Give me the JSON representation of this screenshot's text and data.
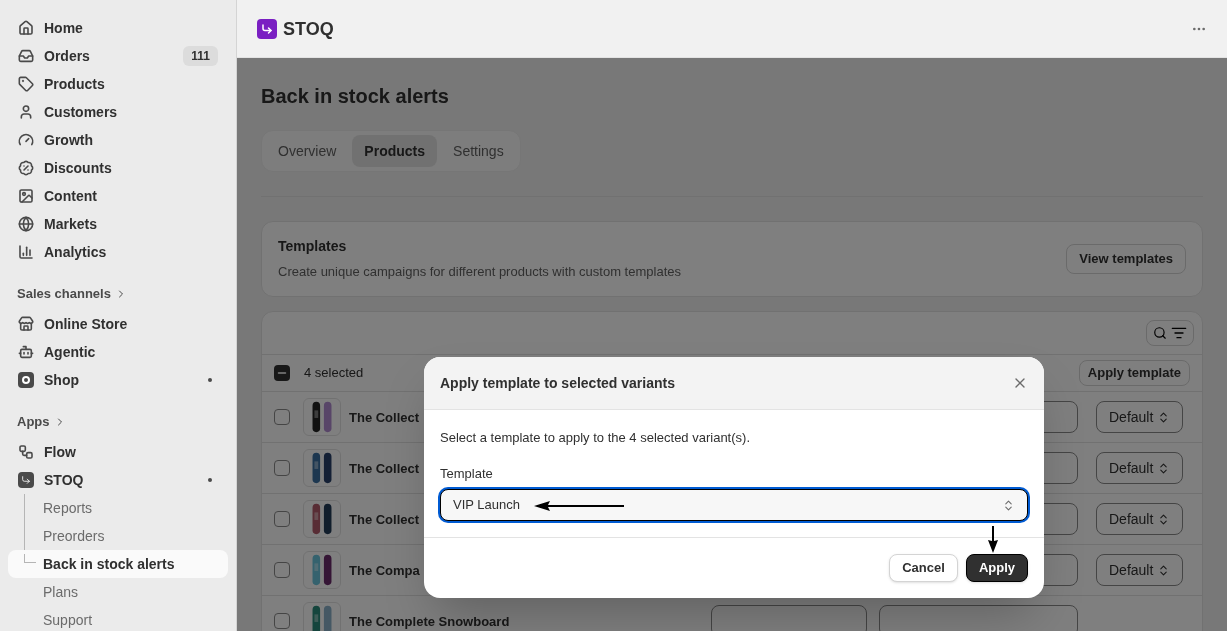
{
  "sidebar": {
    "items": [
      {
        "label": "Home",
        "selected": false
      },
      {
        "label": "Orders",
        "badge": "111",
        "selected": false
      },
      {
        "label": "Products",
        "selected": false
      },
      {
        "label": "Customers",
        "selected": false
      },
      {
        "label": "Growth",
        "selected": false
      },
      {
        "label": "Discounts",
        "selected": false
      },
      {
        "label": "Content",
        "selected": false
      },
      {
        "label": "Markets",
        "selected": false
      },
      {
        "label": "Analytics",
        "selected": false
      }
    ],
    "sections": [
      {
        "title": "Sales channels",
        "items": [
          {
            "label": "Online Store",
            "dot": false,
            "selected": false
          },
          {
            "label": "Agentic",
            "dot": false,
            "selected": false
          },
          {
            "label": "Shop",
            "dot": true,
            "selected": false
          }
        ]
      },
      {
        "title": "Apps",
        "items": [
          {
            "label": "Flow",
            "dot": false,
            "selected": false
          },
          {
            "label": "STOQ",
            "dot": true,
            "selected": false,
            "children": [
              {
                "label": "Reports",
                "selected": false
              },
              {
                "label": "Preorders",
                "selected": false
              },
              {
                "label": "Back in stock alerts",
                "selected": true
              },
              {
                "label": "Plans",
                "selected": false
              },
              {
                "label": "Support",
                "selected": false
              }
            ]
          }
        ]
      }
    ]
  },
  "app_header": {
    "title": "STOQ"
  },
  "page": {
    "title": "Back in stock alerts",
    "tabs": [
      {
        "label": "Overview",
        "selected": false
      },
      {
        "label": "Products",
        "selected": true
      },
      {
        "label": "Settings",
        "selected": false
      }
    ],
    "templates_card": {
      "title": "Templates",
      "description": "Create unique campaigns for different products with custom templates",
      "button": "View templates"
    },
    "table": {
      "selection": {
        "label": "4 selected",
        "indeterminate": true
      },
      "bulk_action": "Apply template",
      "rows": [
        {
          "name": "The Collect",
          "checked": false,
          "template": "Default"
        },
        {
          "name": "The Collect",
          "checked": false,
          "template": "Default"
        },
        {
          "name": "The Collect",
          "checked": false,
          "template": "Default"
        },
        {
          "name": "The Compa",
          "checked": false,
          "template": "Default"
        },
        {
          "name": "The Complete Snowboard",
          "checked": false
        }
      ]
    }
  },
  "modal": {
    "title": "Apply template to selected variants",
    "message": "Select a template to apply to the 4 selected variant(s).",
    "field": {
      "label": "Template",
      "value": "VIP Launch",
      "focused": true
    },
    "buttons": [
      {
        "label": "Cancel",
        "kind": "secondary"
      },
      {
        "label": "Apply",
        "kind": "primary"
      }
    ]
  }
}
